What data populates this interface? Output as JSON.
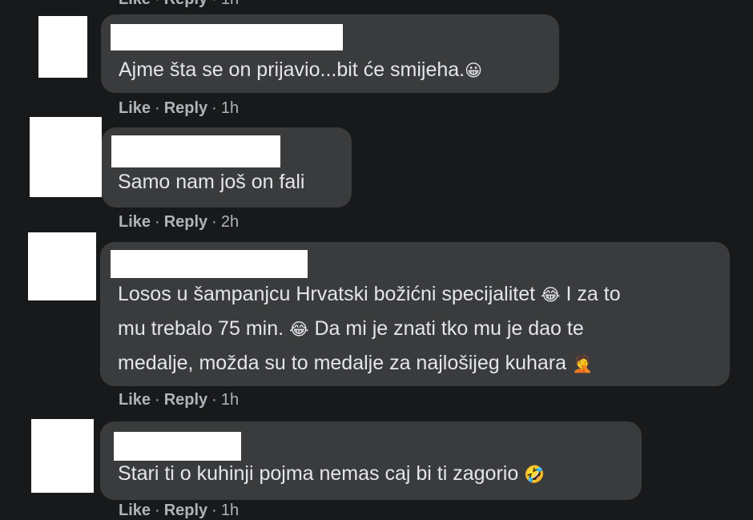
{
  "actions": {
    "like_label": "Like",
    "reply_label": "Reply",
    "separator": "·"
  },
  "comments": [
    {
      "text": "Ajme šta se on prijavio...bit će smijeha.",
      "emoji": "😀",
      "time": "1h"
    },
    {
      "text": "Samo nam još on fali",
      "time": "2h"
    },
    {
      "line1": "Losos u šampanjcu Hrvatski božićni specijalitet ",
      "emoji1": "😂",
      "line1b": " I za to",
      "line2": "mu trebalo 75 min. ",
      "emoji2": "😂",
      "line2b": " Da mi je znati tko mu je dao te",
      "line3": "medalje, možda su to medalje za najlošijeg kuhara ",
      "emoji3": "🤦",
      "time": "1h"
    },
    {
      "text": "Stari ti o kuhinji pojma nemas caj bi ti zagorio ",
      "emoji": "🤣",
      "time": "1h"
    }
  ],
  "colors": {
    "background": "#18191a",
    "bubble": "#3a3b3c",
    "text": "#e4e6eb",
    "meta": "#b0b3b8"
  }
}
